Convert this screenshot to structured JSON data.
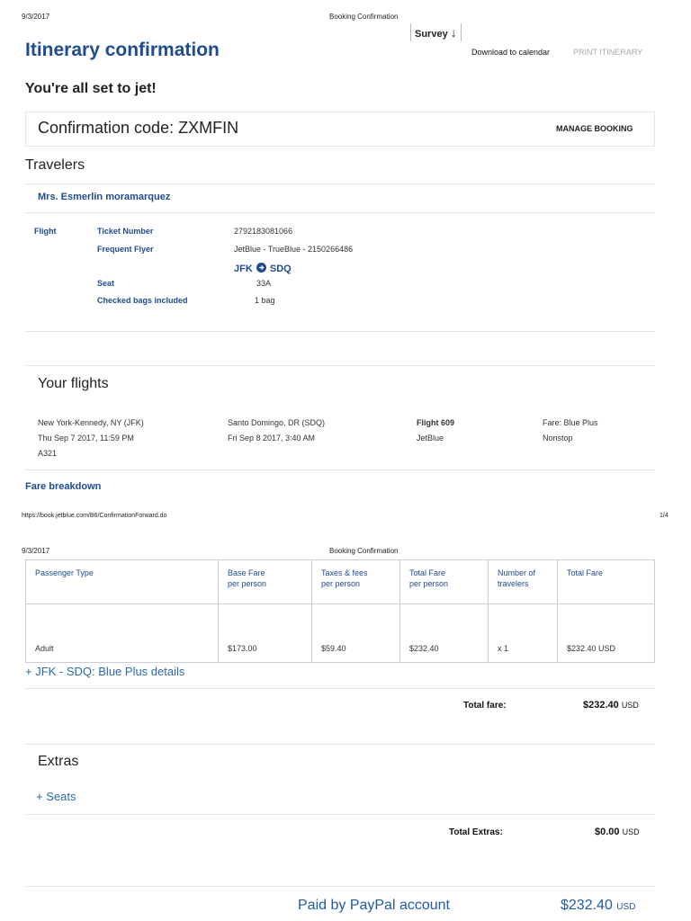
{
  "page1": {
    "print_date": "9/3/2017",
    "print_title": "Booking Confirmation",
    "survey_label": "Survey",
    "survey_arrow": "↓",
    "heading": "Itinerary confirmation",
    "download_calendar": "Download to calendar",
    "print_itinerary": "PRINT ITINERARY",
    "subheading": "You're all set to jet!",
    "confirmation_label": "Confirmation code: ZXMFIN",
    "manage_booking": "MANAGE BOOKING",
    "travelers_heading": "Travelers",
    "traveler_name": "Mrs. Esmerlin moramarquez",
    "flight_label": "Flight",
    "ticket_label": "Ticket Number",
    "ticket_value": "2792183081066",
    "ff_label": "Frequent Flyer",
    "ff_value": "JetBlue - TrueBlue - 2150266486",
    "route_from": "JFK",
    "route_to": "SDQ",
    "seat_label": "Seat",
    "seat_value": "33A",
    "bags_label": "Checked bags included",
    "bags_value": "1 bag",
    "your_flights": "Your flights",
    "flight": {
      "origin": "New York-Kennedy, NY (JFK)",
      "depart": "Thu Sep 7 2017, 11:59 PM",
      "aircraft": "A321",
      "destination": "Santo Domingo, DR (SDQ)",
      "arrive": "Fri Sep 8 2017, 3:40 AM",
      "number": "Flight 609",
      "carrier": "JetBlue",
      "fare": "Fare: Blue Plus",
      "stops": "Nonstop"
    },
    "fare_breakdown": "Fare breakdown",
    "footer_url": "https://book.jetblue.com/B6/ConfirmationForward.do",
    "footer_page": "1/4"
  },
  "page2": {
    "print_date": "9/3/2017",
    "print_title": "Booking Confirmation",
    "table": {
      "headers": [
        {
          "line1": "Passenger Type",
          "line2": ""
        },
        {
          "line1": "Base Fare",
          "line2": "per person"
        },
        {
          "line1": "Taxes & fees",
          "line2": "per person"
        },
        {
          "line1": "Total Fare",
          "line2": "per person"
        },
        {
          "line1": "Number of",
          "line2": "travelers"
        },
        {
          "line1": "Total Fare",
          "line2": ""
        }
      ],
      "row": [
        "Adult",
        "$173.00",
        "$59.40",
        "$232.40",
        "x 1",
        "$232.40 USD"
      ]
    },
    "details_link": "+ JFK - SDQ: Blue Plus details",
    "total_fare_label": "Total fare:",
    "total_fare_value": "$232.40",
    "total_fare_currency": "USD",
    "extras_heading": "Extras",
    "seats_link_plus": "+",
    "seats_link": "Seats",
    "total_extras_label": "Total Extras:",
    "total_extras_value": "$0.00",
    "total_extras_currency": "USD",
    "paid_by": "Paid by PayPal account",
    "paid_value": "$232.40",
    "paid_currency": "USD"
  }
}
